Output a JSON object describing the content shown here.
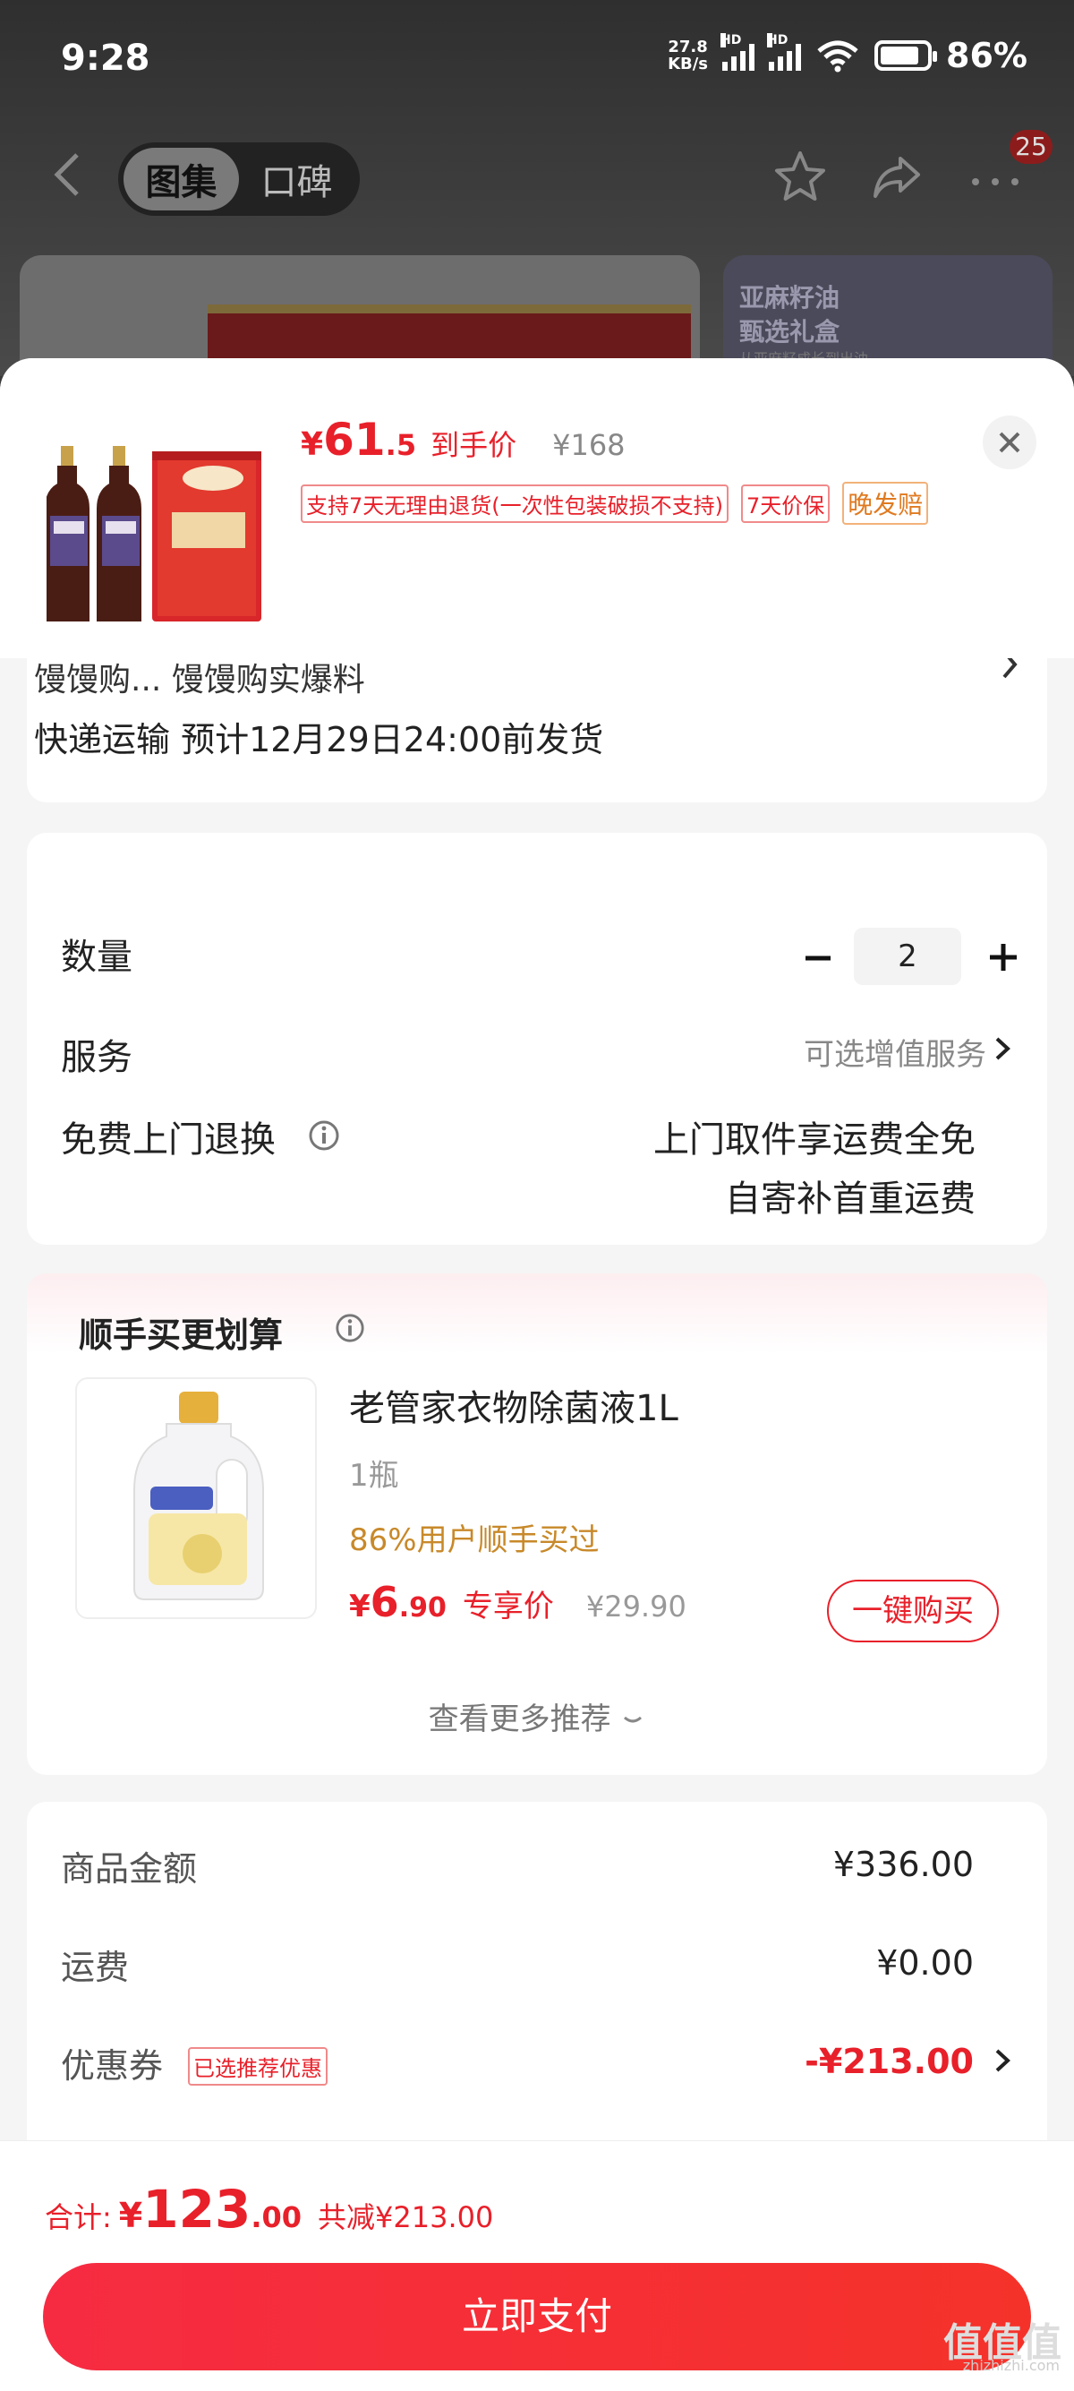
{
  "status_bar": {
    "time": "9:28",
    "net_speed_value": "27.8",
    "net_speed_unit": "KB/s",
    "network_label": "HD",
    "battery": "86%"
  },
  "nav": {
    "tabs": [
      {
        "label": "图集",
        "active": true
      },
      {
        "label": "口碑",
        "active": false
      }
    ],
    "cart_badge": "25",
    "icons": [
      "back-arrow-icon",
      "star-icon",
      "share-icon",
      "more-icon"
    ]
  },
  "background_banner": {
    "line1": "亚麻籽油",
    "line2": "甄选礼盒",
    "line3": "从亚麻籽成长到出油"
  },
  "product": {
    "price_yen": "¥",
    "price_int": "61",
    "price_dec": ".5",
    "price_tag": "到手价",
    "original_price": "¥168",
    "tags": [
      "支持7天无理由退货(一次性包装破损不支持)",
      "7天价保",
      "晚发赔"
    ]
  },
  "shipping": {
    "store_text": "馒馒购... 馒馒购实爆料",
    "line": "快递运输 预计12月29日24:00前发货"
  },
  "options": {
    "quantity_label": "数量",
    "quantity_value": "2",
    "service_label": "服务",
    "service_link": "可选增值服务",
    "return_label": "免费上门退换",
    "return_line1": "上门取件享运费全免",
    "return_line2": "自寄补首重运费"
  },
  "recommend": {
    "title": "顺手买更划算",
    "item_name": "老管家衣物除菌液1L",
    "item_spec": "1瓶",
    "item_bought": "86%用户顺手买过",
    "price_yen": "¥",
    "price_int": "6",
    "price_dec": ".90",
    "price_tag": "专享价",
    "original_price": "¥29.90",
    "buy_button": "一键购买",
    "more_link": "查看更多推荐"
  },
  "summary": {
    "goods_label": "商品金额",
    "goods_value": "¥336.00",
    "shipping_label": "运费",
    "shipping_value": "¥0.00",
    "coupon_label": "优惠券",
    "coupon_badge": "已选推荐优惠",
    "coupon_value": "-¥213.00"
  },
  "footer": {
    "total_label": "合计:",
    "total_yen": "¥",
    "total_int": "123",
    "total_dec": ".00",
    "total_saving": "共减¥213.00",
    "pay_button": "立即支付"
  },
  "watermark": {
    "logo": "值值值",
    "url": "zhizhizhi.com"
  },
  "colors": {
    "accent_red": "#e8202a",
    "orange": "#e07a20",
    "gold": "#c8892a",
    "pay_gradient_start": "#f62b42",
    "pay_gradient_end": "#f5322a"
  }
}
